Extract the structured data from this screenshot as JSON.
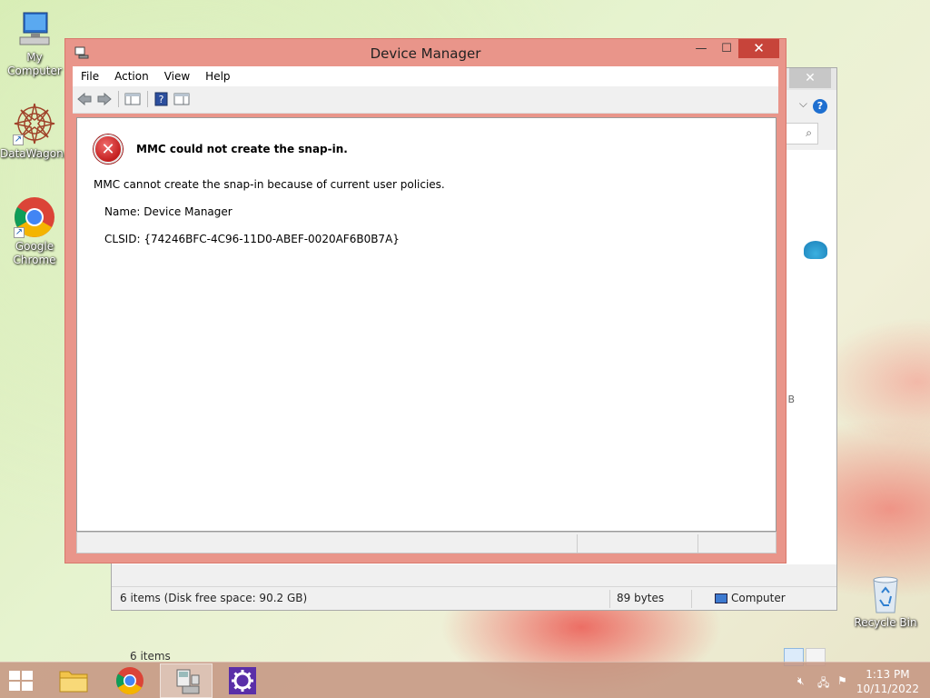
{
  "desktop": {
    "icons": [
      {
        "label": "My Computer"
      },
      {
        "label": "DataWagon..."
      },
      {
        "label": "Google Chrome"
      },
      {
        "label": "Recycle Bin"
      }
    ]
  },
  "bg_window": {
    "close_label": "✕",
    "help_label": "?",
    "size_fragment": "B",
    "items_text": "6 items",
    "status": {
      "items": "6 items (Disk free space: 90.2 GB)",
      "size": "89 bytes",
      "location": "Computer"
    }
  },
  "device_manager": {
    "title": "Device Manager",
    "menu": [
      "File",
      "Action",
      "View",
      "Help"
    ],
    "error": {
      "title": "MMC could not create the snap-in.",
      "message": "MMC cannot create the snap-in because of current user policies.",
      "name_line": "Name: Device Manager",
      "clsid_line": "CLSID: {74246BFC-4C96-11D0-ABEF-0020AF6B0B7A}"
    },
    "colors": {
      "frame": "#e9958a",
      "close": "#c7443a"
    }
  },
  "taskbar": {
    "apps": [
      "file-explorer",
      "google-chrome",
      "device-manager",
      "settings"
    ],
    "time": "1:13 PM",
    "date": "10/11/2022"
  }
}
